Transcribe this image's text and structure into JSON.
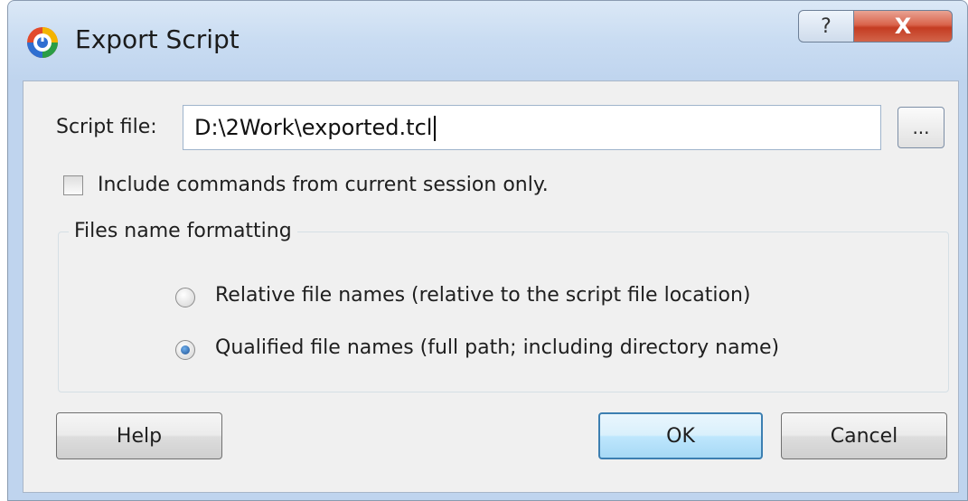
{
  "window": {
    "title": "Export Script",
    "title_help_glyph": "?",
    "title_close_glyph": "X"
  },
  "script_file": {
    "label": "Script file:",
    "value": "D:\\2Work\\exported.tcl",
    "browse_label": "..."
  },
  "include_checkbox": {
    "label": "Include commands from current session only.",
    "checked": false
  },
  "files_name_formatting": {
    "legend": "Files name formatting",
    "options": [
      {
        "label": "Relative file names (relative to the script file location)",
        "selected": false
      },
      {
        "label": "Qualified file names (full path; including directory name)",
        "selected": true
      }
    ]
  },
  "buttons": {
    "help": "Help",
    "ok": "OK",
    "cancel": "Cancel"
  },
  "colors": {
    "accent": "#3c7fb1",
    "close_button": "#c43c22",
    "client_background": "#f0f0f0"
  },
  "icons": {
    "app": "export-script-app-icon",
    "help": "question-mark-icon",
    "close": "close-icon"
  }
}
